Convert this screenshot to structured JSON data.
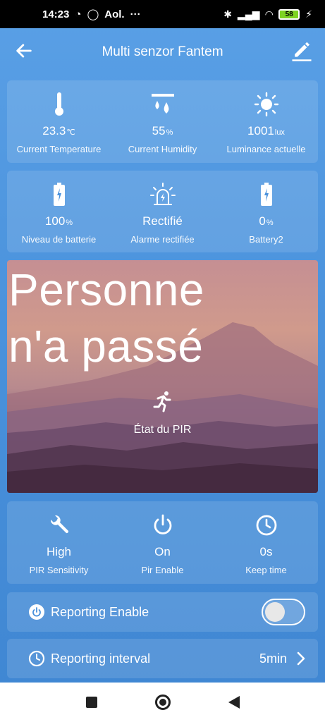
{
  "status_bar": {
    "time": "14:23",
    "carrier": "Aol.",
    "dots": "···",
    "battery": "58"
  },
  "header": {
    "title": "Multi senzor Fantem"
  },
  "sensors_row1": [
    {
      "icon": "thermometer-icon",
      "value": "23.3",
      "unit": "℃",
      "label": "Current Temperature"
    },
    {
      "icon": "humidity-icon",
      "value": "55",
      "unit": "%",
      "label": "Current Humidity"
    },
    {
      "icon": "sun-icon",
      "value": "1001",
      "unit": "lux",
      "label": "Luminance actuelle"
    }
  ],
  "sensors_row2": [
    {
      "icon": "battery-icon",
      "value": "100",
      "unit": "%",
      "label": "Niveau de batterie"
    },
    {
      "icon": "alarm-icon",
      "value": "Rectifié",
      "unit": "",
      "label": "Alarme rectifiée"
    },
    {
      "icon": "battery-icon",
      "value": "0",
      "unit": "%",
      "label": "Battery2"
    }
  ],
  "pir": {
    "status_line1": "Personne",
    "status_line2": "n'a passé",
    "label": "État du PIR"
  },
  "pir_settings": [
    {
      "icon": "wrench-icon",
      "value": "High",
      "label": "PIR Sensitivity"
    },
    {
      "icon": "power-icon",
      "value": "On",
      "label": "Pir Enable"
    },
    {
      "icon": "clock-icon",
      "value": "0s",
      "label": "Keep time"
    }
  ],
  "reporting_enable": {
    "label": "Reporting Enable",
    "enabled": false
  },
  "reporting_interval": {
    "label": "Reporting interval",
    "value": "5min"
  }
}
